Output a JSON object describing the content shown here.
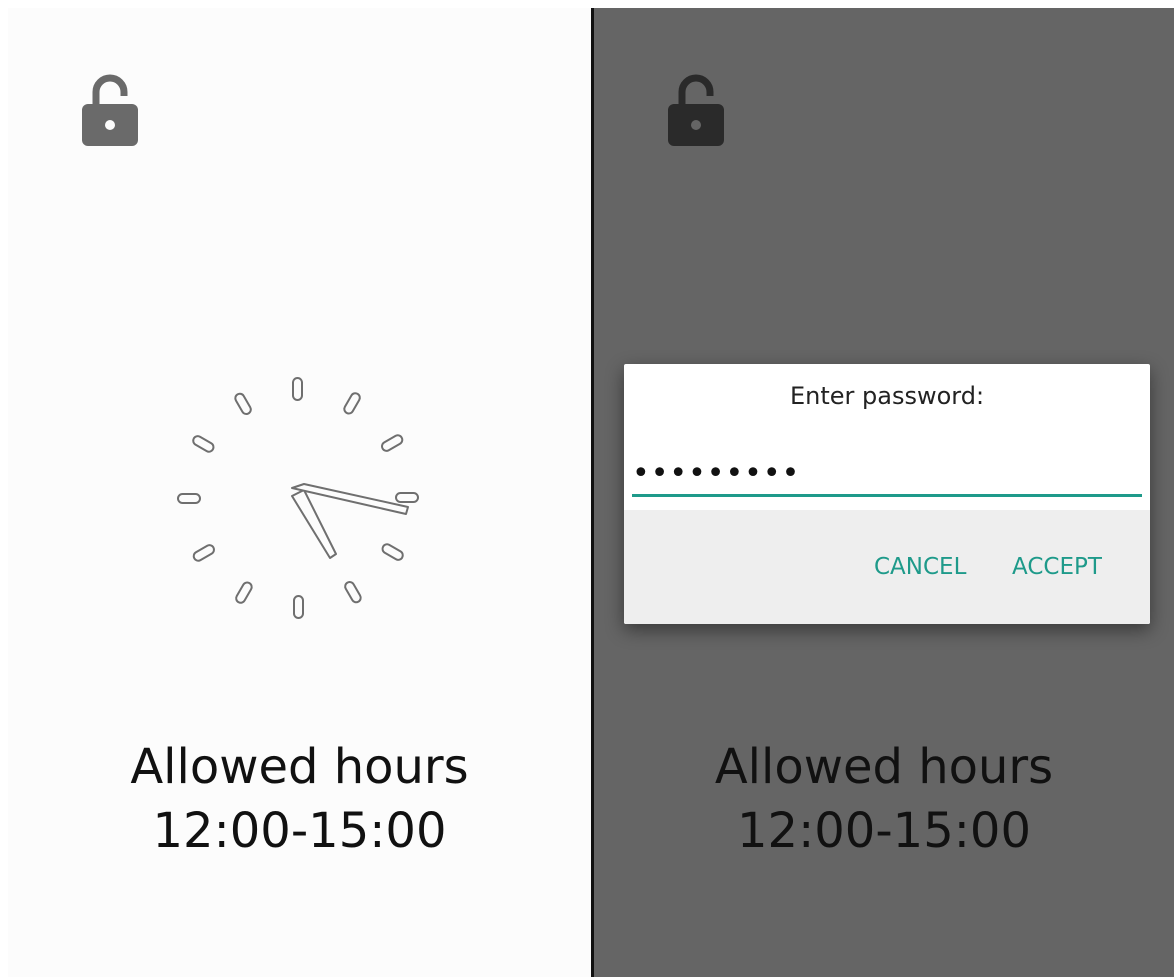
{
  "left_panel": {
    "lock_icon": "lock-open-icon",
    "clock_icon": "analog-clock-icon",
    "allowed_title": "Allowed hours",
    "allowed_hours": "12:00-15:00"
  },
  "right_panel": {
    "lock_icon": "lock-open-icon",
    "allowed_title": "Allowed hours",
    "allowed_hours": "12:00-15:00",
    "dialog": {
      "title": "Enter password:",
      "password_value": "•••••••••",
      "cancel_label": "CANCEL",
      "accept_label": "ACCEPT"
    }
  },
  "colors": {
    "accent": "#1e9a8a",
    "overlay": "#656565",
    "light_bg": "#fcfcfc"
  }
}
